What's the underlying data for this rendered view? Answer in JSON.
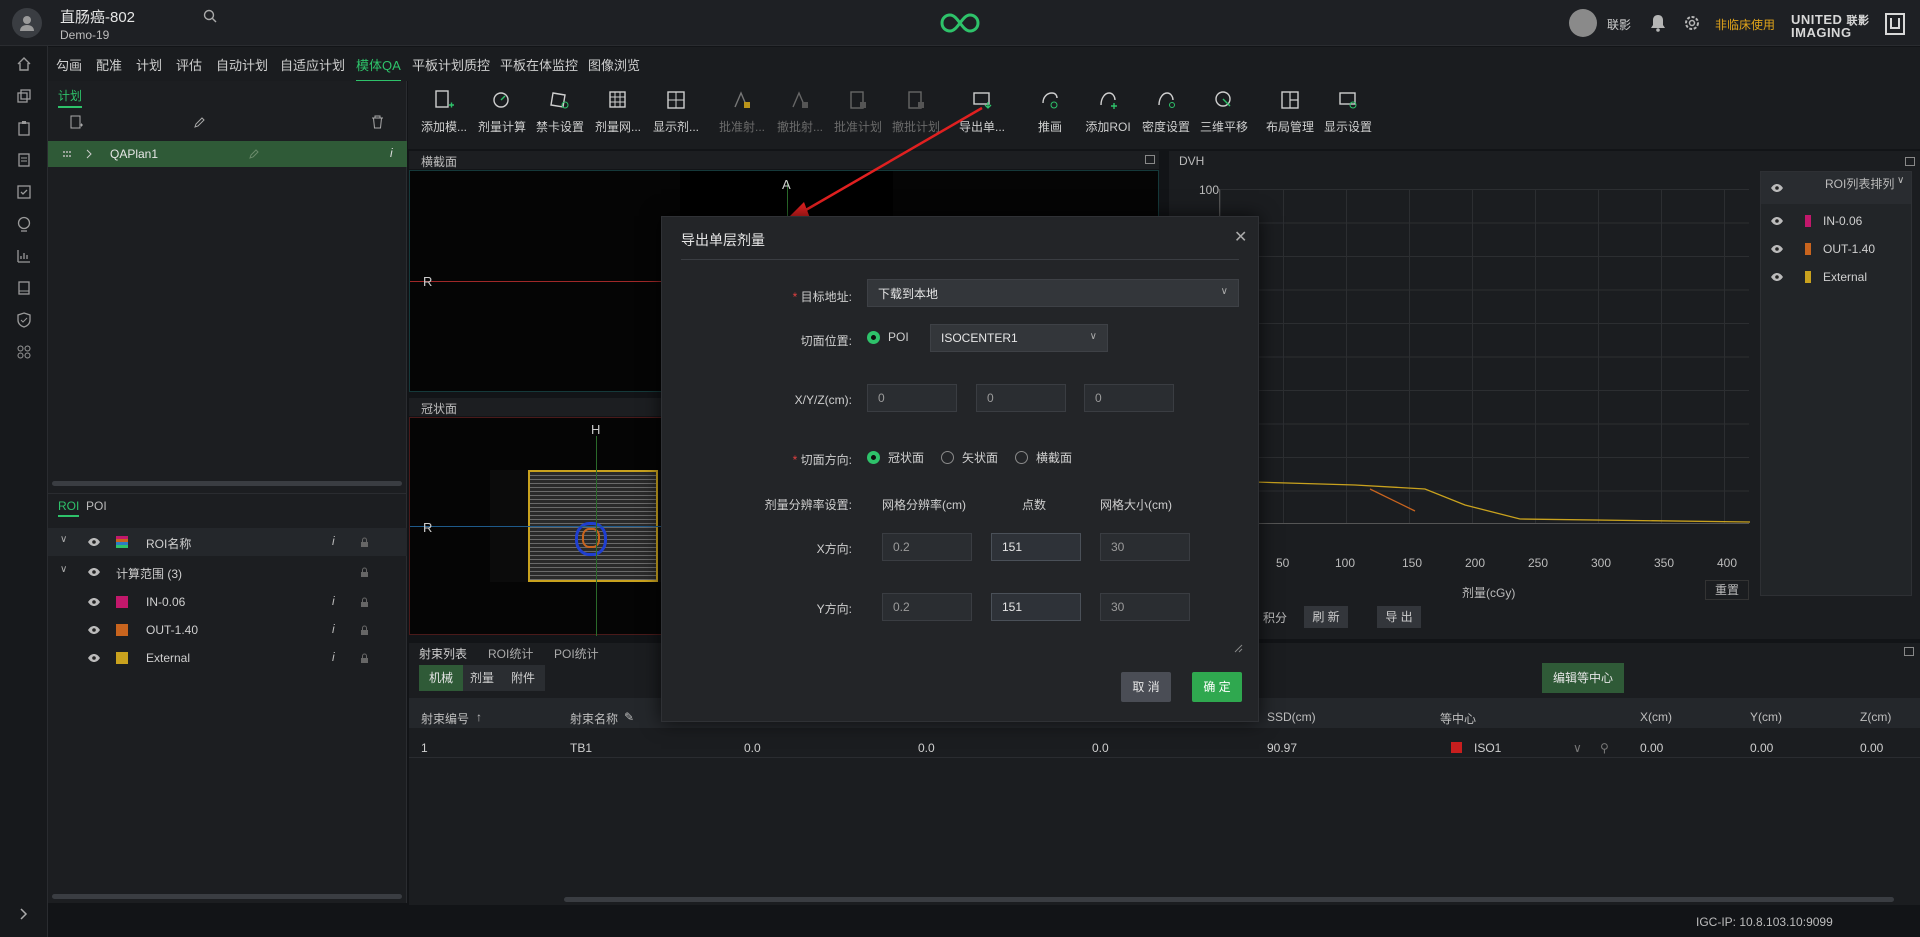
{
  "header": {
    "patient_name": "直肠癌-802",
    "patient_sub": "Demo-19",
    "user": "联影",
    "non_clinical": "非临床使用",
    "brand_line1": "UNITED",
    "brand_cn": "联影",
    "brand_line2": "IMAGING"
  },
  "menu": [
    "勾画",
    "配准",
    "计划",
    "评估",
    "自动计划",
    "自适应计划",
    "模体QA",
    "平板计划质控",
    "平板在体监控",
    "图像浏览"
  ],
  "left_panel": {
    "tab_plan": "计划",
    "plan_item": "QAPlan1",
    "roi_tab": "ROI",
    "poi_tab": "POI",
    "roi_header": "ROI名称",
    "group": "计算范围 (3)",
    "rois": [
      {
        "name": "IN-0.06",
        "color": "#c2186b"
      },
      {
        "name": "OUT-1.40",
        "color": "#c8641e"
      },
      {
        "name": "External",
        "color": "#c9a21e"
      }
    ]
  },
  "toolbar": [
    "添加模...",
    "剂量计算",
    "禁卡设置",
    "剂量网...",
    "显示剂...",
    "批准射...",
    "撤批射...",
    "批准计划",
    "撤批计划",
    "导出单...",
    "推画",
    "添加ROI",
    "密度设置",
    "三维平移",
    "布局管理",
    "显示设置"
  ],
  "views": {
    "transverse": "横截面",
    "coronal": "冠状面",
    "dvh": "DVH",
    "letter_A": "A",
    "letter_R": "R",
    "letter_H": "H"
  },
  "dvh": {
    "y_top": "100",
    "x_ticks": [
      "50",
      "100",
      "150",
      "200",
      "250",
      "300",
      "350",
      "400"
    ],
    "xlabel": "剂量(cGy)",
    "reset": "重置",
    "integral": "积分",
    "refresh": "刷 新",
    "export": "导 出",
    "roi_sort": "ROI列表排列",
    "roi_list": [
      "IN-0.06",
      "OUT-1.40",
      "External"
    ]
  },
  "bottom": {
    "tabs": [
      "射束列表",
      "ROI统计",
      "POI统计"
    ],
    "subtabs": [
      "机械",
      "剂量",
      "附件"
    ],
    "edit_iso": "编辑等中心",
    "headers": [
      "射束编号",
      "射束名称",
      "SSD(cm)",
      "等中心",
      "X(cm)",
      "Y(cm)",
      "Z(cm)"
    ],
    "row": {
      "id": "1",
      "name": "TB1",
      "v1": "0.0",
      "v2": "0.0",
      "v3": "0.0",
      "ssd": "90.97",
      "iso": "ISO1",
      "x": "0.00",
      "y": "0.00",
      "z": "0.00"
    }
  },
  "status": {
    "ip": "IGC-IP: 10.8.103.10:9099"
  },
  "dialog": {
    "title": "导出单层剂量",
    "target_label": "目标地址:",
    "target_value": "下载到本地",
    "slice_pos_label": "切面位置:",
    "poi_option": "POI",
    "poi_value": "ISOCENTER1",
    "xyz_label": "X/Y/Z(cm):",
    "xyz": [
      "0",
      "0",
      "0"
    ],
    "dir_label": "切面方向:",
    "dirs": [
      "冠状面",
      "矢状面",
      "横截面"
    ],
    "res_label": "剂量分辨率设置:",
    "col_res": "网格分辨率(cm)",
    "col_pts": "点数",
    "col_size": "网格大小(cm)",
    "x_label": "X方向:",
    "y_label": "Y方向:",
    "x_vals": [
      "0.2",
      "151",
      "30"
    ],
    "y_vals": [
      "0.2",
      "151",
      "30"
    ],
    "cancel": "取 消",
    "ok": "确 定"
  },
  "colors": {
    "accent": "#2ec26a",
    "plan_sel": "#2f5a37",
    "dvh_curve": "#c9a21e",
    "arrow": "#e02020"
  }
}
